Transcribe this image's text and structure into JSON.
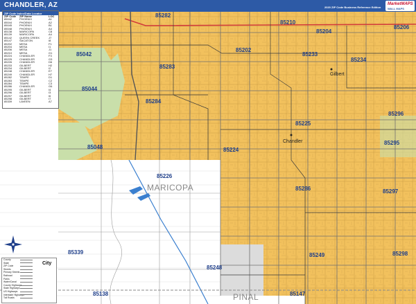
{
  "header": {
    "title": "CHANDLER, AZ",
    "edition": "2020 ZIP Code Business Reference Edition",
    "logo_text": "MarketMAPS",
    "logo_sub": "WALL MAPS"
  },
  "colors": {
    "header_bg": "#2d5aa6",
    "urban_fill": "#f2c15d",
    "rural_fill": "#ffffff",
    "green_area": "#c9dfaa",
    "road": "#7a7a7a",
    "highway": "#d23b3b",
    "canal": "#3a7fcf",
    "zip_label": "#1f3f8a"
  },
  "zip_list": {
    "heading": "ZIP Code Index/Data Locator",
    "columns": [
      "ZIP Code",
      "ZIP Name",
      "LOC"
    ],
    "rows": [
      [
        "85042",
        "PHOENIX",
        "A1"
      ],
      [
        "85044",
        "PHOENIX",
        "A2"
      ],
      [
        "85045",
        "PHOENIX",
        "B1"
      ],
      [
        "85048",
        "PHOENIX",
        "A4"
      ],
      [
        "85138",
        "MARICOPA",
        "C8"
      ],
      [
        "85139",
        "MARICOPA",
        "A4"
      ],
      [
        "85142",
        "QUEEN CREEK",
        "J7"
      ],
      [
        "85147",
        "SACATON",
        "I8"
      ],
      [
        "85202",
        "MESA",
        "F1"
      ],
      [
        "85204",
        "MESA",
        "I1"
      ],
      [
        "85206",
        "MESA",
        "J1"
      ],
      [
        "85210",
        "MESA",
        "G1"
      ],
      [
        "85224",
        "CHANDLER",
        "F3"
      ],
      [
        "85225",
        "CHANDLER",
        "G3"
      ],
      [
        "85226",
        "CHANDLER",
        "D6"
      ],
      [
        "85233",
        "GILBERT",
        "H2"
      ],
      [
        "85234",
        "GILBERT",
        "I2"
      ],
      [
        "85248",
        "CHANDLER",
        "E7"
      ],
      [
        "85249",
        "CHANDLER",
        "H7"
      ],
      [
        "85282",
        "TEMPE",
        "D1"
      ],
      [
        "85283",
        "TEMPE",
        "C2"
      ],
      [
        "85284",
        "TEMPE",
        "C3"
      ],
      [
        "85286",
        "CHANDLER",
        "G6"
      ],
      [
        "85295",
        "GILBERT",
        "I4"
      ],
      [
        "85296",
        "GILBERT",
        "I3"
      ],
      [
        "85297",
        "GILBERT",
        "I6"
      ],
      [
        "85298",
        "GILBERT",
        "I7"
      ],
      [
        "85339",
        "LAVEEN",
        "A7"
      ]
    ]
  },
  "legend": {
    "items": [
      "County",
      "State",
      "ZIP Code",
      "Streets",
      "Primary Streets",
      "Railroad",
      "Parks",
      "Water/Canal",
      "County Highways",
      "State Highways",
      "US Highways",
      "Interstate Highways",
      "Toll Roads"
    ],
    "city_label": "City"
  },
  "map": {
    "zip_labels": [
      "85282",
      "85210",
      "85204",
      "85206",
      "85042",
      "85202",
      "85233",
      "85283",
      "85234",
      "85044",
      "85284",
      "85225",
      "85296",
      "85048",
      "85224",
      "85295",
      "85226",
      "85286",
      "85297",
      "85339",
      "85249",
      "85298",
      "85248",
      "85138",
      "85147"
    ],
    "city_labels": [
      "Gilbert",
      "Chandler"
    ],
    "county_labels": [
      "MARICOPA",
      "PINAL"
    ],
    "compass": "N"
  }
}
